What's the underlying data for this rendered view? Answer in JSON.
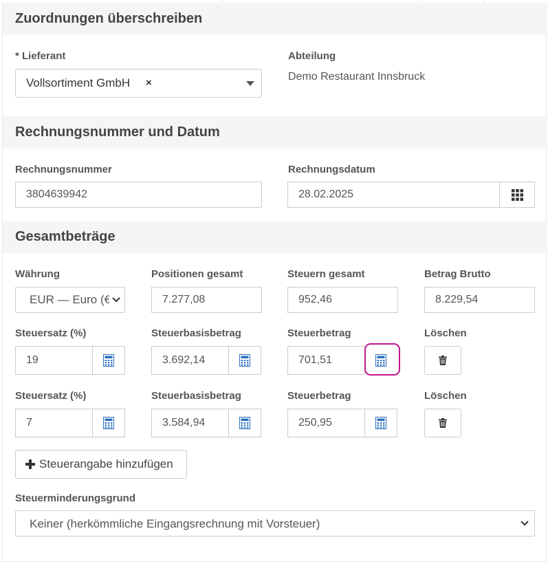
{
  "section_assignments": {
    "title": "Zuordnungen überschreiben",
    "supplier_label": "* Lieferant",
    "supplier_value": "Vollsortiment GmbH",
    "supplier_clear": "×",
    "department_label": "Abteilung",
    "department_value": "Demo Restaurant Innsbruck"
  },
  "section_invoice": {
    "title": "Rechnungsnummer und Datum",
    "number_label": "Rechnungsnummer",
    "number_value": "3804639942",
    "date_label": "Rechnungsdatum",
    "date_value": "28.02.2025"
  },
  "section_totals": {
    "title": "Gesamtbeträge",
    "currency_label": "Währung",
    "currency_value": "EUR — Euro (€",
    "positions_label": "Positionen gesamt",
    "positions_value": "7.277,08",
    "taxes_label": "Steuern gesamt",
    "taxes_value": "952,46",
    "gross_label": "Betrag Brutto",
    "gross_value": "8.229,54"
  },
  "tax_rows": [
    {
      "rate_label": "Steuersatz (%)",
      "rate_value": "19",
      "base_label": "Steuerbasisbetrag",
      "base_value": "3.692,14",
      "amount_label": "Steuerbetrag",
      "amount_value": "701,51",
      "delete_label": "Löschen"
    },
    {
      "rate_label": "Steuersatz (%)",
      "rate_value": "7",
      "base_label": "Steuerbasisbetrag",
      "base_value": "3.584,94",
      "amount_label": "Steuerbetrag",
      "amount_value": "250,95",
      "delete_label": "Löschen"
    }
  ],
  "add_tax_button": "Steuerangabe hinzufügen",
  "reduction": {
    "label": "Steuerminderungsgrund",
    "value": "Keiner (herkömmliche Eingangsrechnung mit Vorsteuer)"
  },
  "icons": {
    "calculator": "calculator-icon",
    "calendar": "calendar-grid-icon",
    "trash": "trash-icon",
    "plus": "plus-icon"
  },
  "colors": {
    "calculator_icon": "#2a6ebb",
    "highlight": "#c0168c",
    "section_bg": "#f5f5f5"
  }
}
